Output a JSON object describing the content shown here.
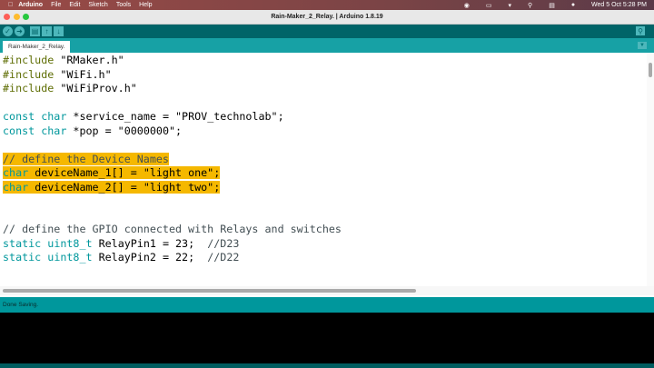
{
  "menubar": {
    "app": "Arduino",
    "items": [
      "File",
      "Edit",
      "Sketch",
      "Tools",
      "Help"
    ],
    "clock": "Wed 5 Oct  5:28 PM"
  },
  "window": {
    "title": "Rain-Maker_2_Relay. | Arduino 1.8.19"
  },
  "tab": {
    "label": "Rain-Maker_2_Relay."
  },
  "colors": {
    "teal": "#00979c",
    "toolbar": "#006468",
    "highlight": "#f5b800"
  },
  "code": [
    [
      {
        "t": "#include",
        "c": "pp"
      },
      {
        "t": " \"RMaker.h\"",
        "c": ""
      }
    ],
    [
      {
        "t": "#include",
        "c": "pp"
      },
      {
        "t": " \"WiFi.h\"",
        "c": ""
      }
    ],
    [
      {
        "t": "#include",
        "c": "pp"
      },
      {
        "t": " \"WiFiProv.h\"",
        "c": ""
      }
    ],
    [],
    [
      {
        "t": "const",
        "c": "kw"
      },
      {
        "t": " ",
        "c": ""
      },
      {
        "t": "char",
        "c": "kw"
      },
      {
        "t": " *service_name = \"PROV_technolab\";",
        "c": ""
      }
    ],
    [
      {
        "t": "const",
        "c": "kw"
      },
      {
        "t": " ",
        "c": ""
      },
      {
        "t": "char",
        "c": "kw"
      },
      {
        "t": " *pop = \"0000000\";",
        "c": ""
      }
    ],
    [],
    [
      {
        "t": "// define the Device Names",
        "c": "cm",
        "hl": true
      }
    ],
    [
      {
        "t": "char",
        "c": "kw",
        "hl": true
      },
      {
        "t": " deviceName_1[] = \"light one\";",
        "c": "",
        "hl": true
      }
    ],
    [
      {
        "t": "char",
        "c": "kw",
        "hl": true
      },
      {
        "t": " deviceName_2[] = \"light two\";",
        "c": "",
        "hl": true
      }
    ],
    [],
    [],
    [
      {
        "t": "// define the GPIO connected with Relays and switches",
        "c": "cm"
      }
    ],
    [
      {
        "t": "static",
        "c": "kw"
      },
      {
        "t": " ",
        "c": ""
      },
      {
        "t": "uint8_t",
        "c": "kw"
      },
      {
        "t": " RelayPin1 = 23;  ",
        "c": ""
      },
      {
        "t": "//D23",
        "c": "cm"
      }
    ],
    [
      {
        "t": "static",
        "c": "kw"
      },
      {
        "t": " ",
        "c": ""
      },
      {
        "t": "uint8_t",
        "c": "kw"
      },
      {
        "t": " RelayPin2 = 22;  ",
        "c": ""
      },
      {
        "t": "//D22",
        "c": "cm"
      }
    ]
  ],
  "status": {
    "message": "Done Saving."
  }
}
